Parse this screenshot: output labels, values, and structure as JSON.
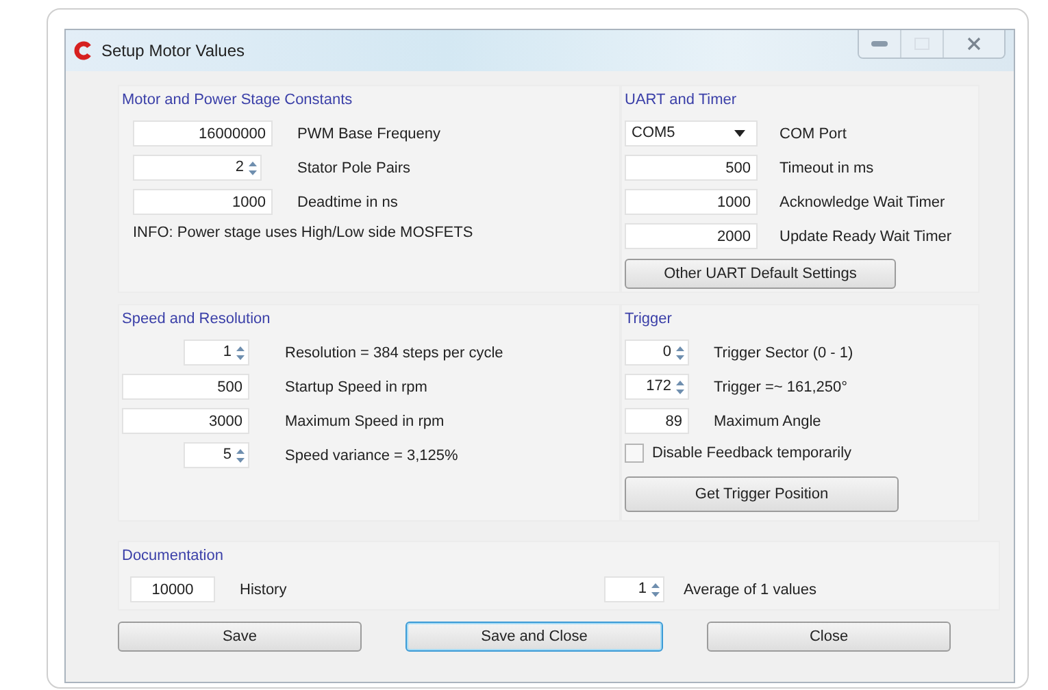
{
  "window": {
    "title": "Setup Motor Values",
    "maximize_disabled": true
  },
  "motor": {
    "title": "Motor and Power Stage Constants",
    "rows": [
      {
        "kind": "text",
        "value": "16000000",
        "label": "PWM Base Frequeny"
      },
      {
        "kind": "spin",
        "value": "2",
        "label": "Stator Pole Pairs"
      },
      {
        "kind": "text",
        "value": "1000",
        "label": "Deadtime in ns"
      }
    ],
    "info": "INFO: Power stage uses High/Low side MOSFETS"
  },
  "uart": {
    "title": "UART and Timer",
    "rows": [
      {
        "kind": "combo",
        "value": "COM5",
        "label": "COM Port"
      },
      {
        "kind": "text",
        "value": "500",
        "label": "Timeout in ms"
      },
      {
        "kind": "text",
        "value": "1000",
        "label": "Acknowledge Wait Timer"
      },
      {
        "kind": "text",
        "value": "2000",
        "label": "Update Ready Wait Timer"
      }
    ],
    "button": "Other UART Default Settings"
  },
  "speed": {
    "title": "Speed and Resolution",
    "rows": [
      {
        "kind": "spin",
        "value": "1",
        "label": "Resolution = 384 steps per cycle"
      },
      {
        "kind": "text",
        "value": "500",
        "label": "Startup Speed in rpm"
      },
      {
        "kind": "text",
        "value": "3000",
        "label": "Maximum Speed in rpm"
      },
      {
        "kind": "spin",
        "value": "5",
        "label": "Speed variance = 3,125%"
      }
    ]
  },
  "trigger": {
    "title": "Trigger",
    "rows": [
      {
        "kind": "spin",
        "value": "0",
        "label": "Trigger Sector (0 - 1)"
      },
      {
        "kind": "spin",
        "value": "172",
        "label": "Trigger =~ 161,250°"
      },
      {
        "kind": "text",
        "value": "89",
        "label": "Maximum Angle"
      }
    ],
    "checkbox": {
      "label": "Disable Feedback temporarily",
      "checked": false
    },
    "button": "Get Trigger Position"
  },
  "documentation": {
    "title": "Documentation",
    "rows": [
      {
        "kind": "text",
        "value": "10000",
        "label": "History"
      },
      {
        "kind": "spin",
        "value": "1",
        "label": "Average of 1 values"
      }
    ]
  },
  "buttons": [
    {
      "label": "Save",
      "default": false
    },
    {
      "label": "Save and Close",
      "default": true
    },
    {
      "label": "Close",
      "default": false
    }
  ]
}
